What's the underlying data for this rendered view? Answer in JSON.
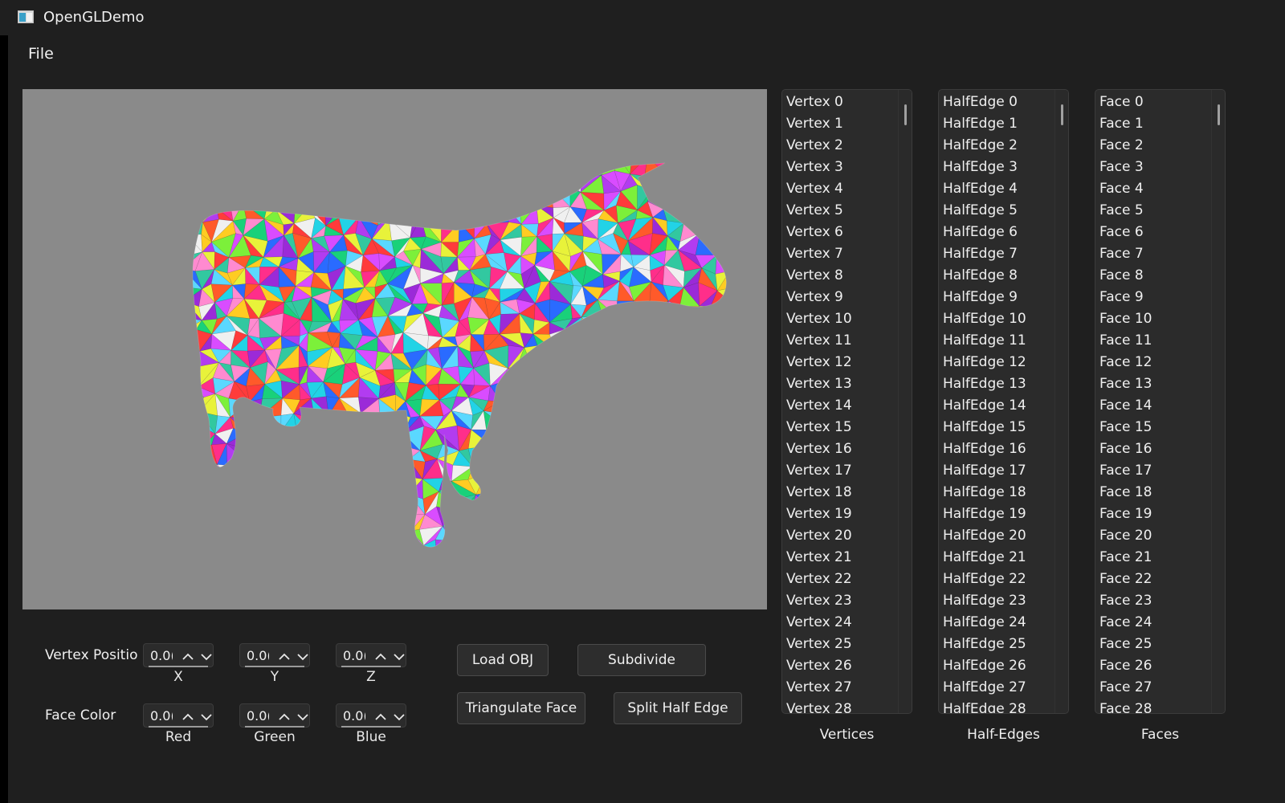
{
  "window": {
    "title": "OpenGLDemo"
  },
  "menu": {
    "file_label": "File"
  },
  "vertex_position": {
    "label": "Vertex Positio",
    "x": {
      "value": "0.0(",
      "caption": "X"
    },
    "y": {
      "value": "0.0(",
      "caption": "Y"
    },
    "z": {
      "value": "0.0(",
      "caption": "Z"
    }
  },
  "face_color": {
    "label": "Face Color",
    "red": {
      "value": "0.0(",
      "caption": "Red"
    },
    "green": {
      "value": "0.0(",
      "caption": "Green"
    },
    "blue": {
      "value": "0.0(",
      "caption": "Blue"
    }
  },
  "buttons": {
    "load_obj": "Load OBJ",
    "subdivide": "Subdivide",
    "triangulate_face": "Triangulate Face",
    "split_half_edge": "Split Half Edge"
  },
  "lists": {
    "vertices": {
      "caption": "Vertices",
      "items": [
        "Vertex 0",
        "Vertex 1",
        "Vertex 2",
        "Vertex 3",
        "Vertex 4",
        "Vertex 5",
        "Vertex 6",
        "Vertex 7",
        "Vertex 8",
        "Vertex 9",
        "Vertex 10",
        "Vertex 11",
        "Vertex 12",
        "Vertex 13",
        "Vertex 14",
        "Vertex 15",
        "Vertex 16",
        "Vertex 17",
        "Vertex 18",
        "Vertex 19",
        "Vertex 20",
        "Vertex 21",
        "Vertex 22",
        "Vertex 23",
        "Vertex 24",
        "Vertex 25",
        "Vertex 26",
        "Vertex 27",
        "Vertex 28"
      ]
    },
    "half_edges": {
      "caption": "Half-Edges",
      "items": [
        "HalfEdge 0",
        "HalfEdge 1",
        "HalfEdge 2",
        "HalfEdge 3",
        "HalfEdge 4",
        "HalfEdge 5",
        "HalfEdge 6",
        "HalfEdge 7",
        "HalfEdge 8",
        "HalfEdge 9",
        "HalfEdge 10",
        "HalfEdge 11",
        "HalfEdge 12",
        "HalfEdge 13",
        "HalfEdge 14",
        "HalfEdge 15",
        "HalfEdge 16",
        "HalfEdge 17",
        "HalfEdge 18",
        "HalfEdge 19",
        "HalfEdge 20",
        "HalfEdge 21",
        "HalfEdge 22",
        "HalfEdge 23",
        "HalfEdge 24",
        "HalfEdge 25",
        "HalfEdge 26",
        "HalfEdge 27",
        "HalfEdge 28"
      ]
    },
    "faces": {
      "caption": "Faces",
      "items": [
        "Face 0",
        "Face 1",
        "Face 2",
        "Face 3",
        "Face 4",
        "Face 5",
        "Face 6",
        "Face 7",
        "Face 8",
        "Face 9",
        "Face 10",
        "Face 11",
        "Face 12",
        "Face 13",
        "Face 14",
        "Face 15",
        "Face 16",
        "Face 17",
        "Face 18",
        "Face 19",
        "Face 20",
        "Face 21",
        "Face 22",
        "Face 23",
        "Face 24",
        "Face 25",
        "Face 26",
        "Face 27",
        "Face 28"
      ]
    }
  },
  "colors": {
    "background": "#1f1f1f",
    "viewport_background": "#8a8a8a",
    "mesh_palette": [
      "#ff2e8a",
      "#22d3e6",
      "#7cf03a",
      "#b23cf0",
      "#ffcc22",
      "#ff5a2a",
      "#2a6bff",
      "#19d17a",
      "#f0f0f0",
      "#9b2ad8",
      "#e8f23a",
      "#ff3b3b",
      "#32c8a0",
      "#d94cff",
      "#5ad8ff",
      "#ff8ad0"
    ]
  },
  "icons": {
    "app": "app-window-icon",
    "spin_up": "chevron-up-icon",
    "spin_down": "chevron-down-icon"
  }
}
